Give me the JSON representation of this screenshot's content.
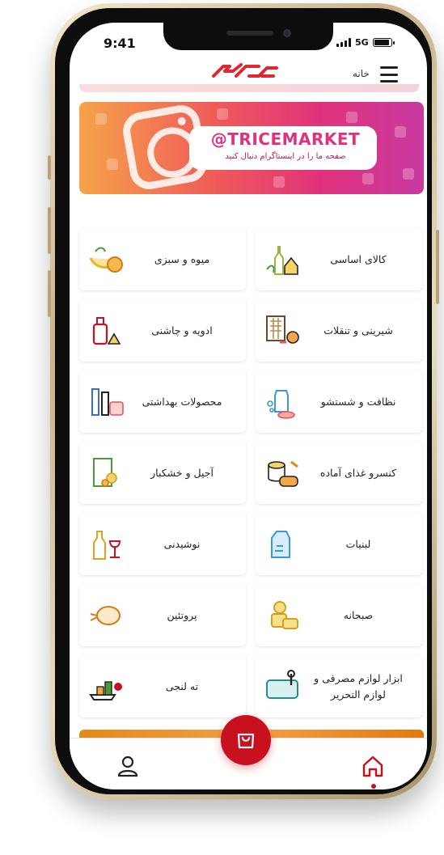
{
  "status_bar": {
    "time": "9:41",
    "network": "5G",
    "battery_level": 0.9
  },
  "header": {
    "home_label": "خانه",
    "brand_color": "#e0262e"
  },
  "banner": {
    "handle": "@TRICEMARKET",
    "tagline": "صفحه ما را در اینستاگرام دنبال کنید"
  },
  "categories": [
    {
      "label": "کالای اساسی",
      "icon": "basic-goods-icon"
    },
    {
      "label": "میوه و سبزی",
      "icon": "fruit-vegetable-icon"
    },
    {
      "label": "شیرینی و تنقلات",
      "icon": "sweets-snacks-icon"
    },
    {
      "label": "ادویه و چاشنی",
      "icon": "spices-condiments-icon"
    },
    {
      "label": "نظافت و شستشو",
      "icon": "cleaning-icon"
    },
    {
      "label": "محصولات بهداشتی",
      "icon": "hygiene-products-icon"
    },
    {
      "label": "کنسرو غذای آماده",
      "icon": "canned-food-icon"
    },
    {
      "label": "آجیل و خشکبار",
      "icon": "nuts-dried-fruit-icon"
    },
    {
      "label": "لبنیات",
      "icon": "dairy-icon"
    },
    {
      "label": "نوشیدنی",
      "icon": "beverage-icon"
    },
    {
      "label": "صبحانه",
      "icon": "breakfast-icon"
    },
    {
      "label": "پروتئین",
      "icon": "protein-icon"
    },
    {
      "label": "ابزار لوازم مصرفی و لوازم التحریر",
      "icon": "stationery-tools-icon"
    },
    {
      "label": "ته لنجی",
      "icon": "import-goods-icon"
    }
  ],
  "bottom_nav": {
    "active": "home",
    "accent": "#c8101e"
  }
}
